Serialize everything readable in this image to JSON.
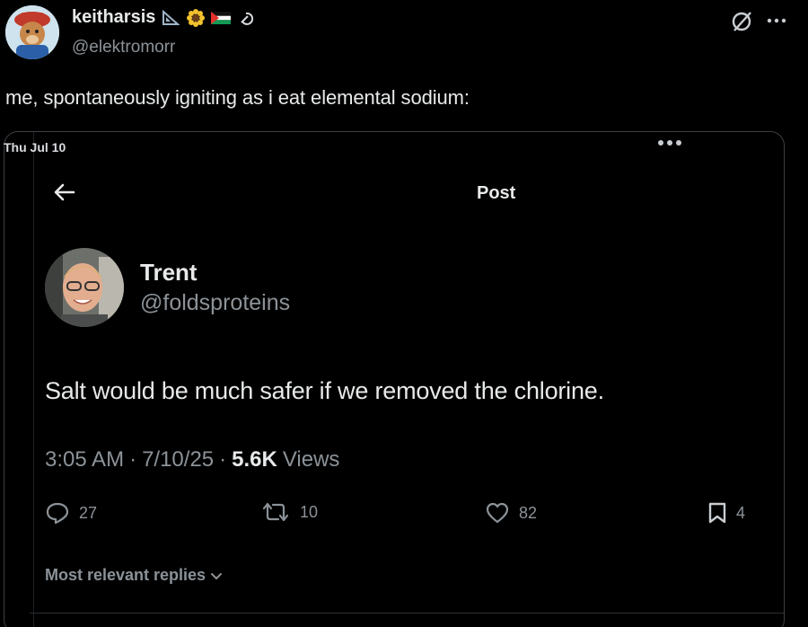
{
  "outer_post": {
    "display_name": "keitharsis",
    "handle": "@elektromorr",
    "text": "me, spontaneously igniting as i eat elemental sodium:",
    "name_emojis": [
      "ruler-triangle-icon",
      "sunflower-icon",
      "palestine-flag-icon",
      "hammer-sickle-icon"
    ]
  },
  "top_icons": [
    "grok-icon",
    "more-icon"
  ],
  "embed": {
    "date": "Thu Jul 10",
    "header_title": "Post",
    "author_name": "Trent",
    "author_handle": "@foldsproteins",
    "text": "Salt would be much safer if we removed the chlorine.",
    "time": "3:05 AM",
    "separator": "·",
    "date_short": "7/10/25",
    "views_count": "5.6K",
    "views_label": "Views",
    "actions": {
      "replies": "27",
      "reposts": "10",
      "likes": "82",
      "bookmarks": "4"
    },
    "replies_filter": "Most relevant replies"
  }
}
